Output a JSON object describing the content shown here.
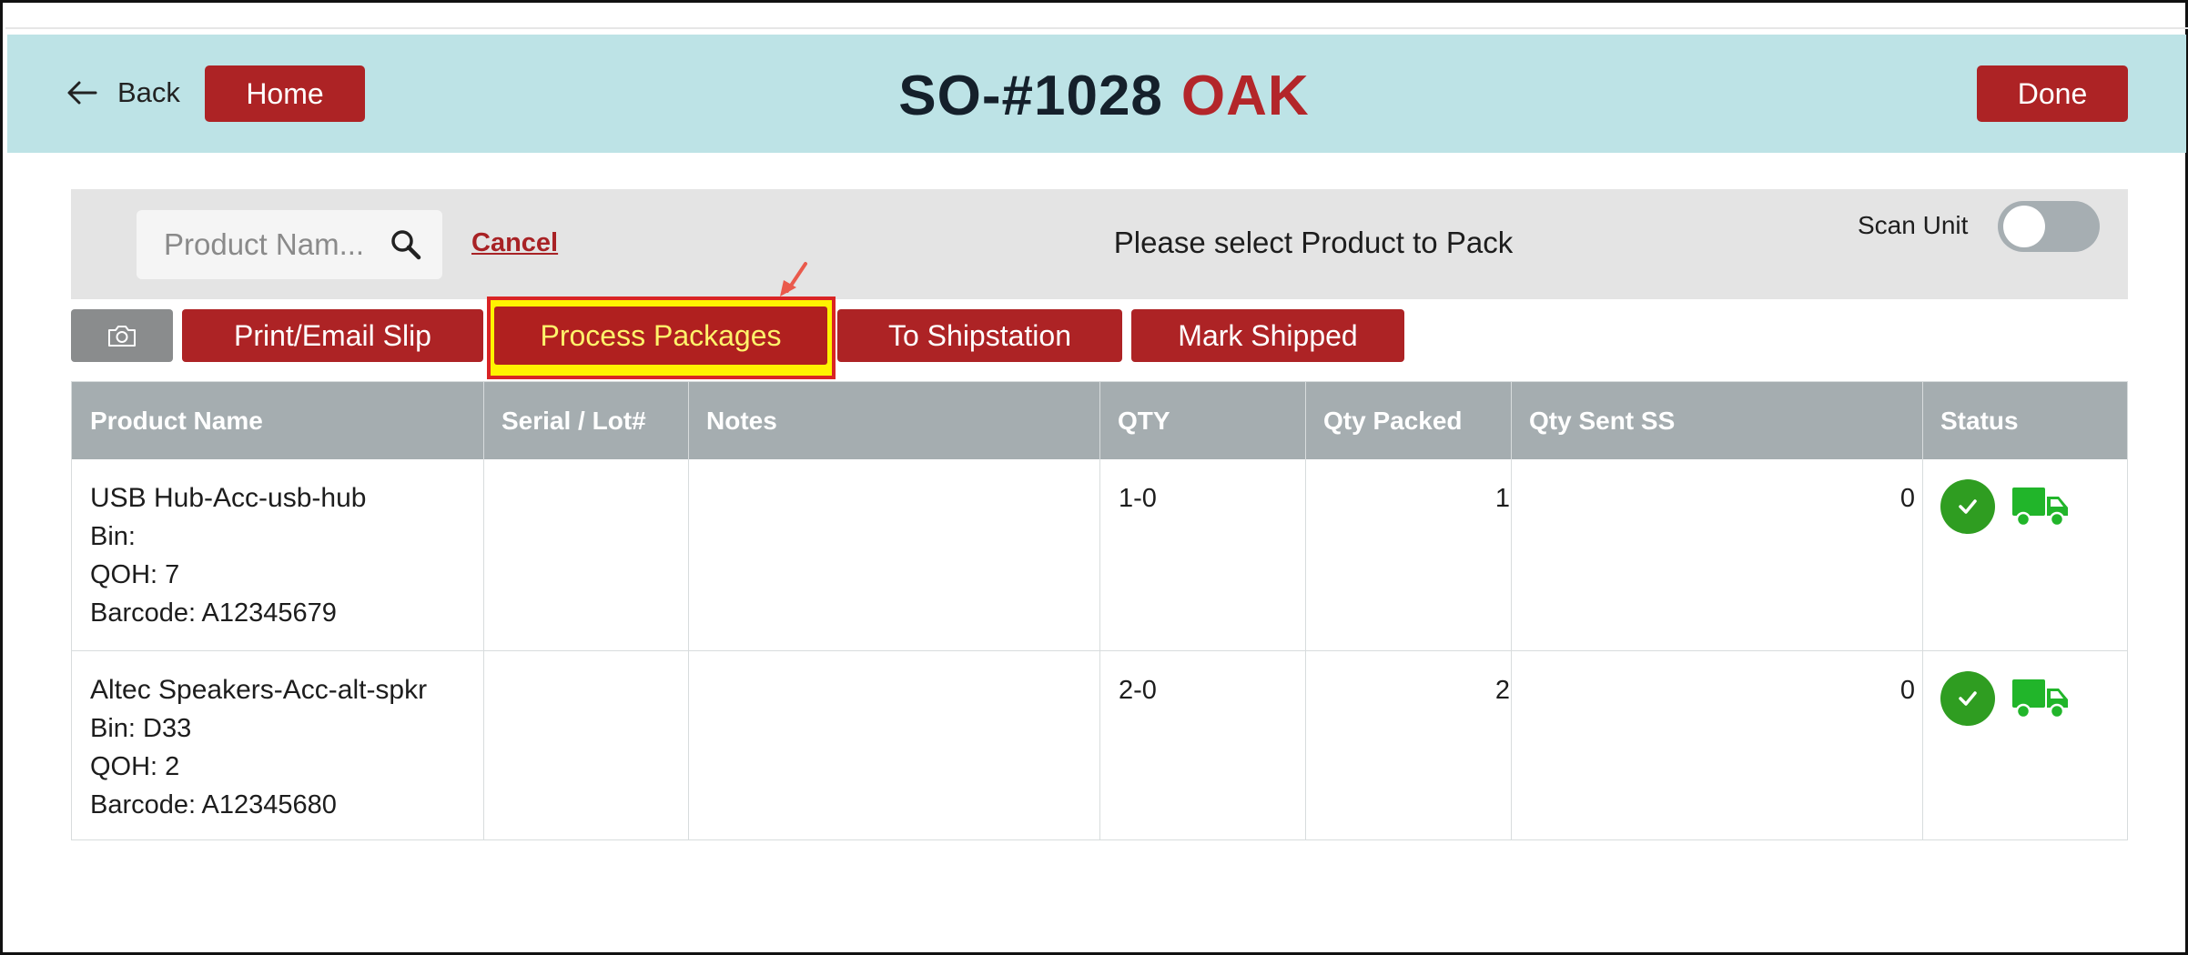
{
  "header": {
    "back_label": "Back",
    "home_label": "Home",
    "order_number": "SO-#1028",
    "location": "OAK",
    "done_label": "Done"
  },
  "toolbar": {
    "search_placeholder": "Product Nam...",
    "cancel_label": "Cancel",
    "prompt": "Please select Product to Pack",
    "scan_unit_label": "Scan Unit",
    "scan_unit_on": false
  },
  "actions": {
    "camera_icon": "camera-icon",
    "print_label": "Print/Email Slip",
    "process_label": "Process Packages",
    "shipstation_label": "To Shipstation",
    "mark_shipped_label": "Mark Shipped"
  },
  "table": {
    "headers": [
      "Product Name",
      "Serial / Lot#",
      "Notes",
      "QTY",
      "Qty Packed",
      "Qty Sent SS",
      "Status"
    ],
    "rows": [
      {
        "name": "USB Hub-Acc-usb-hub",
        "bin": "Bin:",
        "qoh": "QOH: 7",
        "barcode": "Barcode: A12345679",
        "serial": "",
        "notes": "",
        "qty": "1-0",
        "qty_packed": "1",
        "qty_sent": "0",
        "status_icons": [
          "check-circle-icon",
          "truck-icon"
        ]
      },
      {
        "name": "Altec Speakers-Acc-alt-spkr",
        "bin": "Bin: D33",
        "qoh": "QOH: 2",
        "barcode": "Barcode: A12345680",
        "serial": "",
        "notes": "",
        "qty": "2-0",
        "qty_packed": "2",
        "qty_sent": "0",
        "status_icons": [
          "check-circle-icon",
          "truck-icon"
        ]
      }
    ]
  },
  "colors": {
    "header_bg": "#bde3e6",
    "brand_red": "#ad2325",
    "highlight_yellow": "#fff200",
    "status_green": "#2f9d21",
    "truck_green": "#21b52a"
  }
}
